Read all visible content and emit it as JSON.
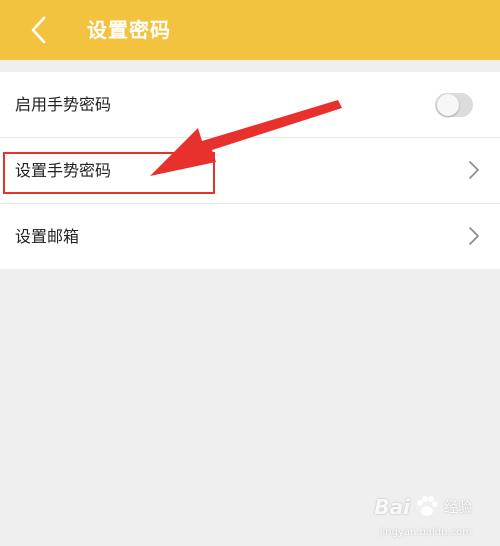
{
  "header": {
    "title": "设置密码"
  },
  "settings": {
    "items": [
      {
        "label": "启用手势密码",
        "control": "toggle",
        "enabled": false
      },
      {
        "label": "设置手势密码",
        "control": "chevron"
      },
      {
        "label": "设置邮箱",
        "control": "chevron"
      }
    ]
  },
  "annotation": {
    "box_color": "#e8312c",
    "arrow_color": "#e8312c"
  },
  "watermark": {
    "brand": "Bai",
    "brand_suffix": "经验",
    "domain": "jingyan.baidu.com"
  },
  "colors": {
    "header_bg": "#f3c33f",
    "page_bg": "#efefef"
  }
}
